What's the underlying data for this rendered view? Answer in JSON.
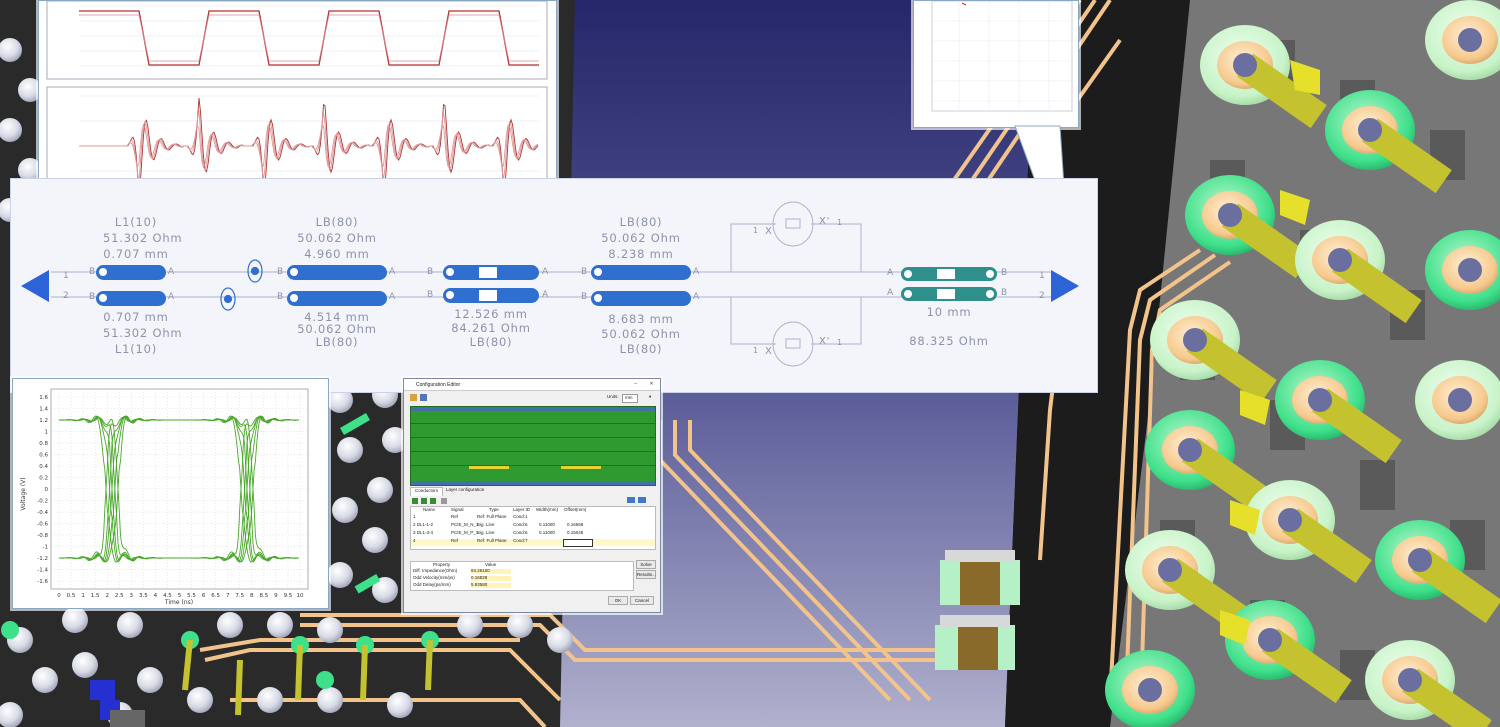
{
  "colors": {
    "canvas_top": "#2a2c66",
    "canvas_bottom": "#a9aac9",
    "board": "#1f1f1f",
    "trace": "#f2c48c",
    "schematic_blue": "#2f6fd0",
    "schematic_teal": "#2f8f8a",
    "port_arrow": "#2d63d6",
    "label_gray": "#8d93ac",
    "eye_green": "#4aa82a",
    "wave_red": "#b03030"
  },
  "schematic": {
    "port_left": {
      "pin1": "1",
      "pin2": "2",
      "icon": "port-triangle-left-icon"
    },
    "port_right": {
      "pin1": "1",
      "pin2": "2",
      "icon": "port-triangle-right-icon"
    },
    "segments": [
      {
        "top": [
          "L1(10)",
          "51.302 Ohm",
          "0.707 mm"
        ],
        "bottom": [
          "0.707 mm",
          "51.302 Ohm",
          "L1(10)"
        ]
      },
      {
        "top": [
          "LB(80)",
          "50.062 Ohm",
          "4.960 mm"
        ],
        "bottom": [
          "4.514 mm",
          "50.062 Ohm",
          "LB(80)"
        ]
      },
      {
        "top": [],
        "bottom": [
          "12.526 mm",
          "84.261 Ohm",
          "LB(80)"
        ]
      },
      {
        "top": [
          "LB(80)",
          "50.062 Ohm",
          "8.238 mm"
        ],
        "bottom": [
          "8.683 mm",
          "50.062 Ohm",
          "LB(80)"
        ]
      },
      {
        "top": [],
        "bottom": [
          "10 mm",
          "88.325 Ohm"
        ]
      }
    ],
    "pin_labels": {
      "b": "B",
      "a": "A",
      "one": "1",
      "x": "X",
      "xprime": "X'"
    }
  },
  "eye_plot": {
    "ylabel": "Voltage (V)",
    "xlabel": "Time (ns)",
    "yticks": [
      "1.6",
      "1.4",
      "1.2",
      "1",
      "0.8",
      "0.6",
      "0.4",
      "0.2",
      "0",
      "-0.2",
      "-0.4",
      "-0.6",
      "-0.8",
      "-1",
      "-1.2",
      "-1.4",
      "-1.6"
    ],
    "xticks": [
      "0",
      "0.5",
      "1",
      "1.5",
      "2",
      "2.5",
      "3",
      "3.5",
      "4",
      "4.5",
      "5",
      "5.5",
      "6",
      "6.5",
      "7",
      "7.5",
      "8",
      "8.5",
      "9",
      "9.5",
      "10"
    ]
  },
  "config_editor": {
    "title": "Configuration Editor",
    "units_label": "Units:",
    "units_value": "mm",
    "tabs": [
      "Conductors",
      "Layer configuration"
    ],
    "table_headers": [
      "Name",
      "Signal",
      "Type",
      "Layer ID",
      "Width(mm)",
      "Offset(mm)"
    ],
    "table_rows": [
      [
        "1",
        "Ref",
        "Ref: Full Plane",
        "Cond:1",
        "",
        ""
      ],
      [
        "2  DL1-1-2",
        "PCIE_M_N_1",
        "Sig. Line",
        "Cond:6",
        "0.11000",
        "0.16558"
      ],
      [
        "3  DL1-3-4",
        "PCIE_M_P_1",
        "Sig. Line",
        "Cond:6",
        "0.11000",
        "0.15048"
      ],
      [
        "4",
        "Ref",
        "Ref: Full Plane",
        "Cond:7",
        "",
        ""
      ]
    ],
    "prop_headers": [
      "Property",
      "Value"
    ],
    "props": [
      [
        "Diff. Impedance(Ohm)",
        "84.26100"
      ],
      [
        "Odd Velocity(mm/ps)",
        "0.16828"
      ],
      [
        "Odd Delay(ps/mm)",
        "5.93580"
      ]
    ],
    "buttons": {
      "solve": "Solve",
      "results": "Results...",
      "ok": "OK",
      "cancel": "Cancel"
    }
  }
}
